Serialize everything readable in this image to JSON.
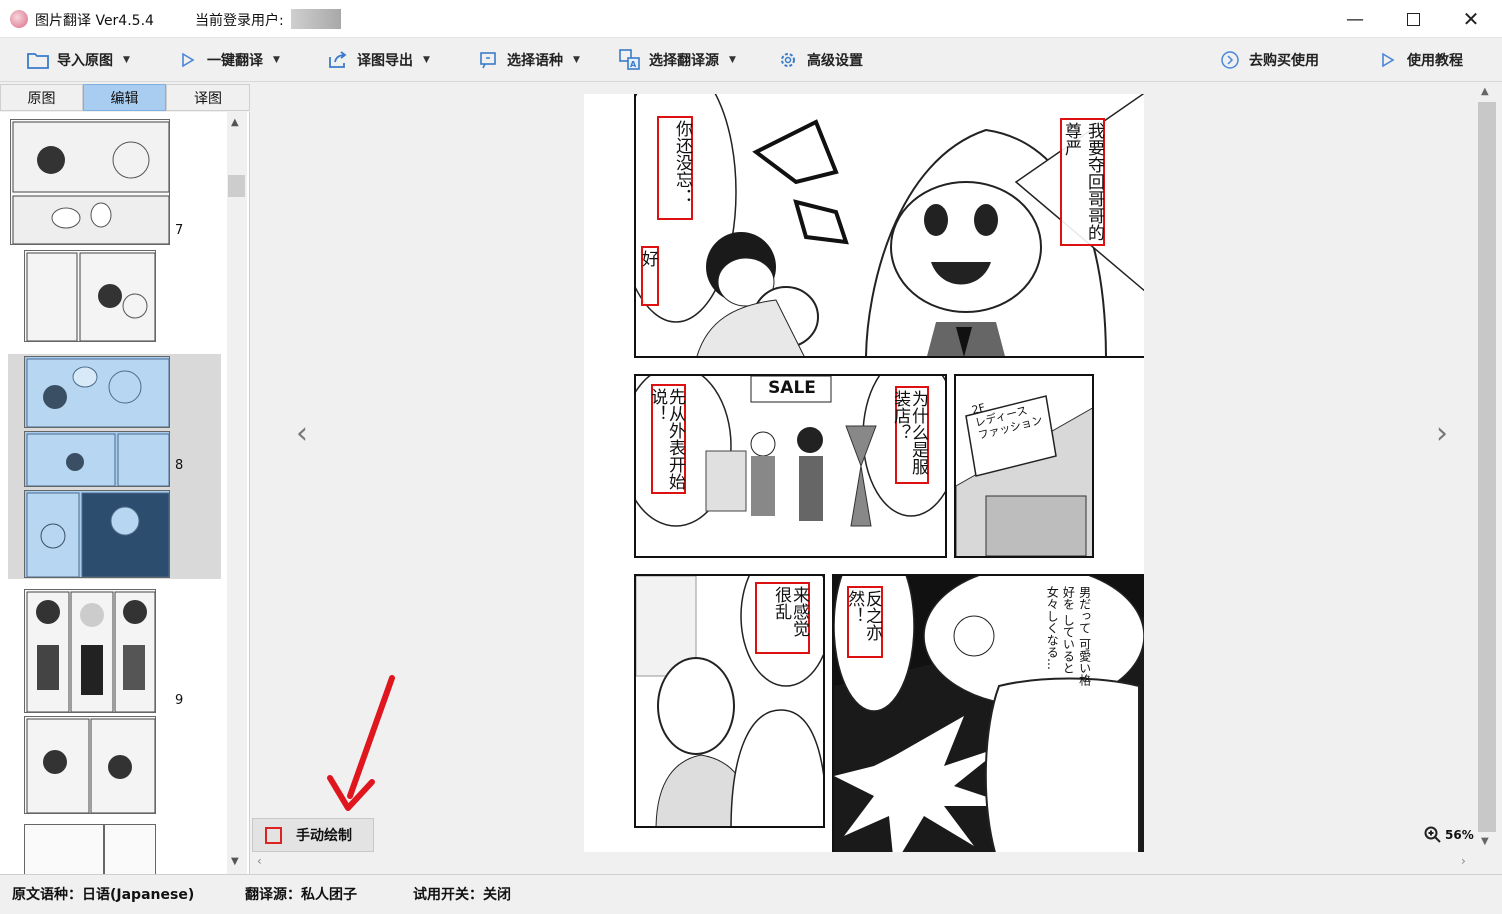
{
  "window": {
    "title": "图片翻译 Ver4.5.4",
    "user_label": "当前登录用户:",
    "controls": [
      "minimize",
      "maximize",
      "close"
    ]
  },
  "toolbar": {
    "import": "导入原图",
    "one_click": "一键翻译",
    "export": "译图导出",
    "language": "选择语种",
    "source": "选择翻译源",
    "advanced": "高级设置",
    "buy": "去购买使用",
    "tutorial": "使用教程"
  },
  "tabs": [
    "原图",
    "编辑",
    "译图"
  ],
  "tabs_active": "编辑",
  "thumbnails": [
    {
      "page": "7"
    },
    {
      "page": "8",
      "selected": true
    },
    {
      "page": "9"
    }
  ],
  "manga": {
    "sfx_sale": "SALE",
    "sign_text": "2F\nレディース\nファッション",
    "vertical_jp": [
      "男だって",
      "可愛い格好を",
      "していると",
      "女々しくなる…"
    ],
    "translations": [
      "你还没忘．．",
      "好",
      "我要夺回哥哥的",
      "尊严",
      "先从外表开始说！",
      "为什么是服装店？",
      "来感觉很乱",
      "反之亦然！"
    ]
  },
  "viewer": {
    "manual_draw": "手动绘制",
    "zoom": "56%"
  },
  "status": {
    "source_lang": "原文语种：日语(Japanese)",
    "engine": "翻译源：私人团子",
    "trial": "试用开关：关闭"
  },
  "colors": {
    "accent_tab": "#a9cdf0",
    "text_box_border": "#dd1111",
    "annotation_arrow": "#e0161e"
  }
}
